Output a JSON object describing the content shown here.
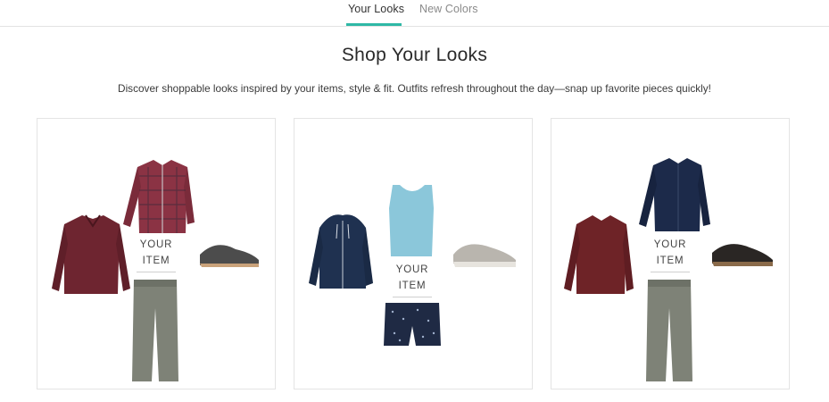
{
  "tabs": [
    {
      "label": "Your Looks",
      "active": true
    },
    {
      "label": "New Colors",
      "active": false
    }
  ],
  "colors": {
    "accent": "#2fb8a6"
  },
  "page": {
    "title": "Shop Your Looks",
    "subtitle": "Discover shoppable looks inspired by your items, style & fit. Outfits refresh throughout the day—snap up favorite pieces quickly!"
  },
  "looks": [
    {
      "your_item_line1": "YOUR",
      "your_item_line2": "ITEM",
      "items": [
        "burgundy-quarter-zip-sweater",
        "red-plaid-shirt",
        "grey-casual-sneakers",
        "grey-chino-pants"
      ]
    },
    {
      "your_item_line1": "YOUR",
      "your_item_line2": "ITEM",
      "items": [
        "navy-zip-hoodie",
        "light-blue-tank-top",
        "grey-sneakers",
        "navy-print-shorts"
      ]
    },
    {
      "your_item_line1": "YOUR",
      "your_item_line2": "ITEM",
      "items": [
        "burgundy-sweater",
        "navy-button-shirt",
        "black-oxford-shoes",
        "grey-chino-pants"
      ]
    }
  ]
}
